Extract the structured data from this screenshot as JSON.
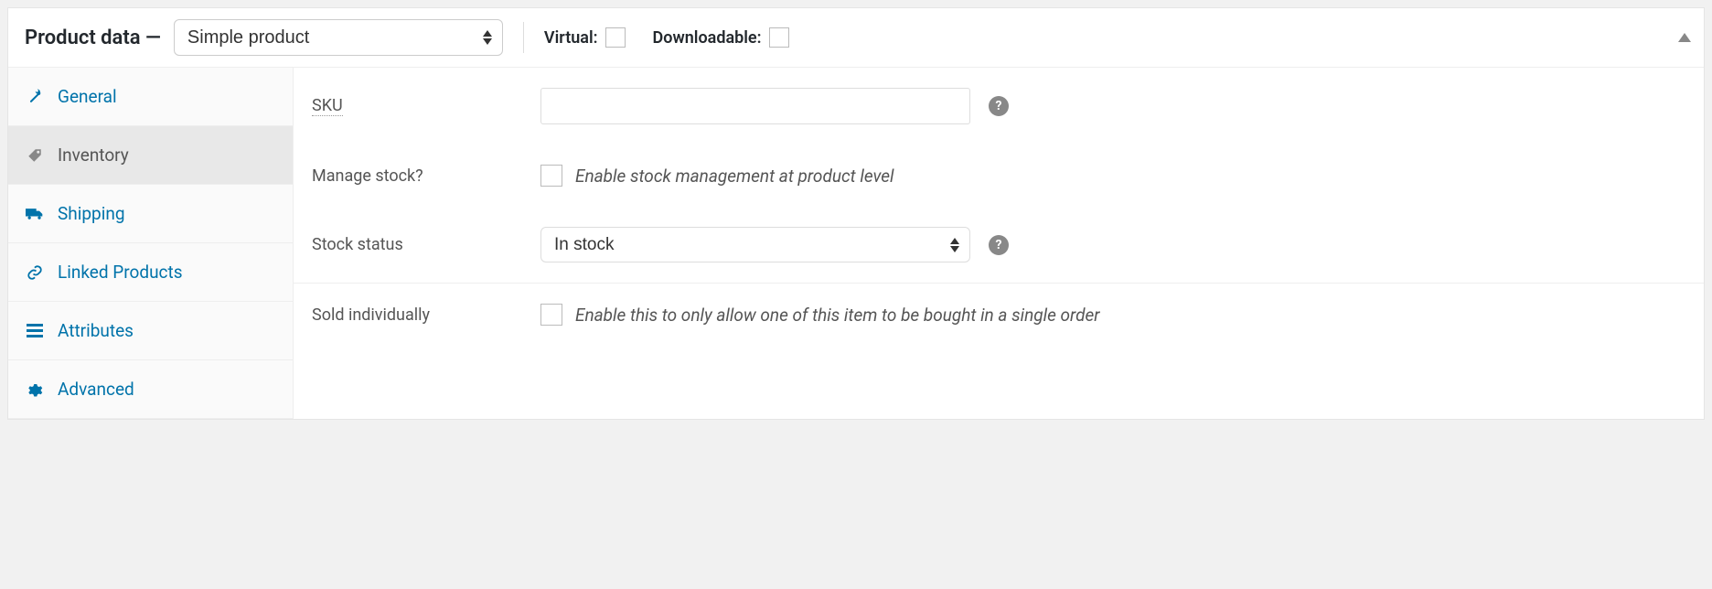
{
  "header": {
    "title": "Product data —",
    "product_type_selected": "Simple product",
    "virtual_label": "Virtual:",
    "virtual_checked": false,
    "downloadable_label": "Downloadable:",
    "downloadable_checked": false
  },
  "tabs": [
    {
      "id": "general",
      "label": "General",
      "icon": "wrench",
      "active": false
    },
    {
      "id": "inventory",
      "label": "Inventory",
      "icon": "tag",
      "active": true
    },
    {
      "id": "shipping",
      "label": "Shipping",
      "icon": "truck",
      "active": false
    },
    {
      "id": "linked",
      "label": "Linked Products",
      "icon": "link",
      "active": false
    },
    {
      "id": "attributes",
      "label": "Attributes",
      "icon": "list",
      "active": false
    },
    {
      "id": "advanced",
      "label": "Advanced",
      "icon": "gear",
      "active": false
    }
  ],
  "inventory": {
    "sku_label": "SKU",
    "sku_value": "",
    "manage_stock_label": "Manage stock?",
    "manage_stock_checked": false,
    "manage_stock_desc": "Enable stock management at product level",
    "stock_status_label": "Stock status",
    "stock_status_selected": "In stock",
    "sold_individually_label": "Sold individually",
    "sold_individually_checked": false,
    "sold_individually_desc": "Enable this to only allow one of this item to be bought in a single order"
  }
}
